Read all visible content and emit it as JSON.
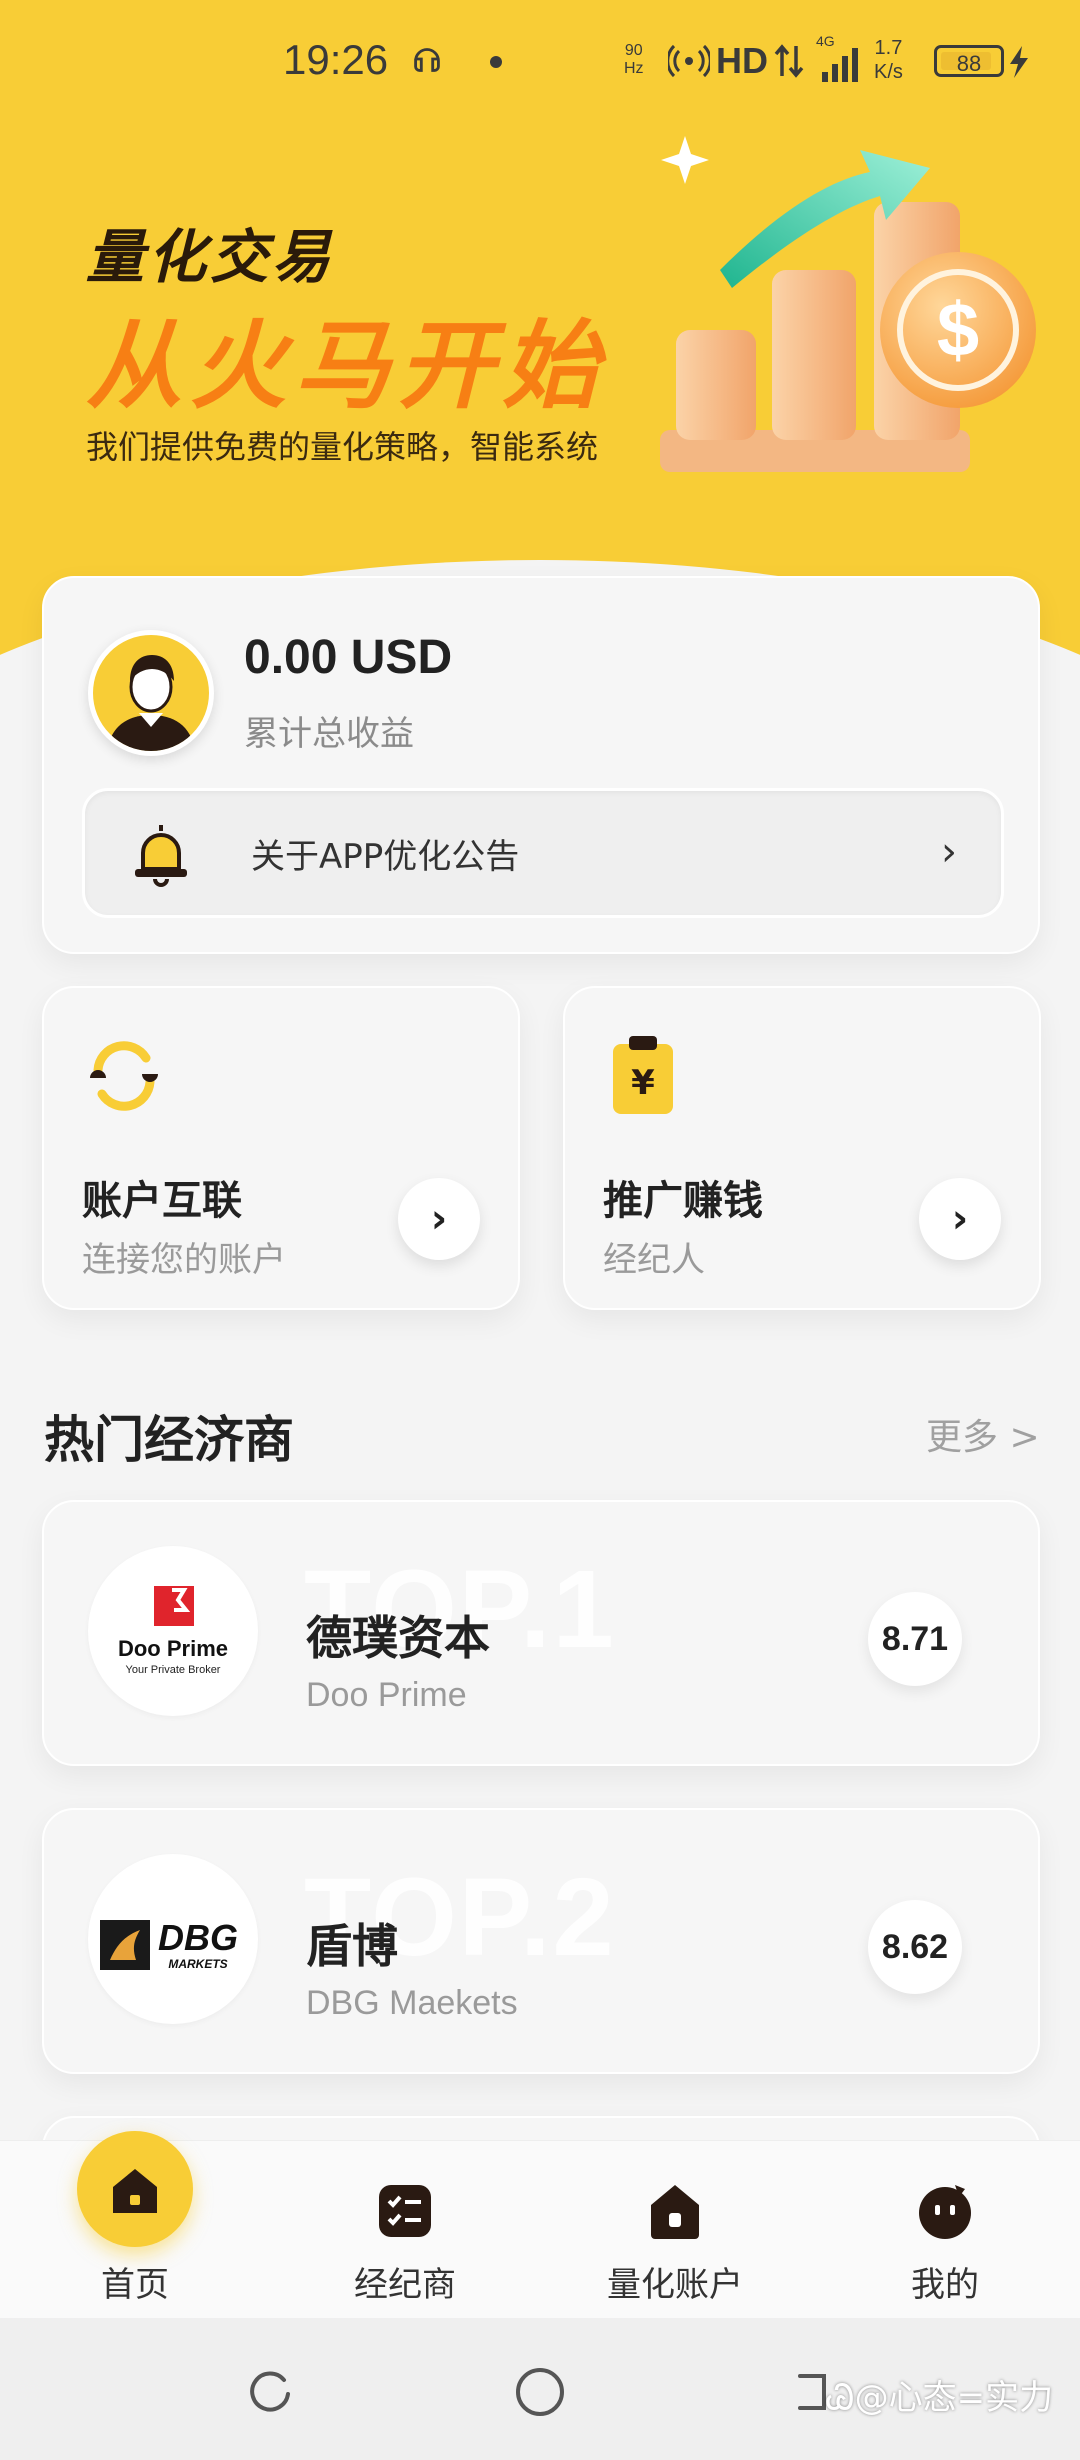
{
  "status_bar": {
    "time": "19:26",
    "refresh_top": "90",
    "refresh_bottom": "Hz",
    "hd": "HD",
    "network": "4G",
    "speed_top": "1.7",
    "speed_bottom": "K/s",
    "battery": "88"
  },
  "banner": {
    "title_line1": "量化交易",
    "title_line2": "从火马开始",
    "subtitle": "我们提供免费的量化策略，智能系统",
    "accent_color": "#f77f14",
    "background_color": "#f8cd36"
  },
  "profile": {
    "amount": "0.00 USD",
    "amount_label": "累计总收益",
    "notice_text": "关于APP优化公告"
  },
  "quick_actions": [
    {
      "title": "账户互联",
      "subtitle": "连接您的账户",
      "icon": "link-cycle-icon"
    },
    {
      "title": "推广赚钱",
      "subtitle": "经纪人",
      "icon": "yuan-clipboard-icon"
    }
  ],
  "section": {
    "title": "热门经济商",
    "more": "更多 >"
  },
  "brokers": [
    {
      "rank_watermark": "TOP.1",
      "name": "德璞资本",
      "name_en": "Doo Prime",
      "score": "8.71",
      "logo_text": "Doo Prime",
      "logo_tagline": "Your Private Broker"
    },
    {
      "rank_watermark": "TOP.2",
      "name": "盾博",
      "name_en": "DBG Maekets",
      "score": "8.62",
      "logo_text": "DBG",
      "logo_tagline": "MARKETS"
    }
  ],
  "tabbar": {
    "items": [
      {
        "label": "首页",
        "icon": "home-icon",
        "active": true
      },
      {
        "label": "经纪商",
        "icon": "checklist-icon",
        "active": false
      },
      {
        "label": "量化账户",
        "icon": "account-house-icon",
        "active": false
      },
      {
        "label": "我的",
        "icon": "profile-face-icon",
        "active": false
      }
    ]
  },
  "watermark": "心态=实力"
}
